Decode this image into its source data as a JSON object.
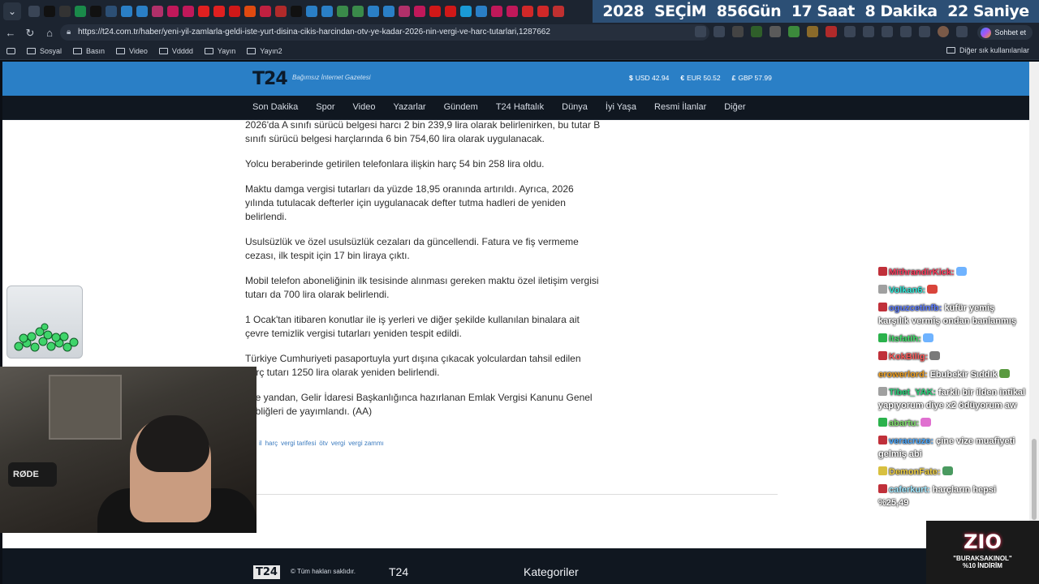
{
  "browser": {
    "countdown": [
      "2028",
      "SEÇİM",
      "856Gün",
      "17 Saat",
      "8 Dakika",
      "22 Saniye"
    ],
    "url": "https://t24.com.tr/haber/yeni-yil-zamlarla-geldi-iste-yurt-disina-cikis-harcindan-otv-ye-kadar-2026-nin-vergi-ve-harc-tutarlari,1287662",
    "sohbet_label": "Sohbet et",
    "bookmarks": [
      "Sosyal",
      "Basın",
      "Video",
      "Vdddd",
      "Yayın",
      "Yayın2"
    ],
    "bookmarks_other": "Diğer sık kullanılanlar"
  },
  "site": {
    "logo": "T24",
    "tagline": "Bağımsız İnternet Gazetesi",
    "rates": [
      {
        "sym": "$",
        "label": "USD 42.94"
      },
      {
        "sym": "€",
        "label": "EUR 50.52"
      },
      {
        "sym": "£",
        "label": "GBP 57.99"
      }
    ],
    "nav": [
      "Son Dakika",
      "Spor",
      "Video",
      "Yazarlar",
      "Gündem",
      "T24 Haftalık",
      "Dünya",
      "İyi Yaşa",
      "Resmi İlanlar",
      "Diğer"
    ]
  },
  "article": {
    "paragraphs": [
      "2026'da A sınıfı sürücü belgesi harcı 2 bin 239,9 lira olarak belirlenirken, bu tutar B sınıfı sürücü belgesi harçlarında 6 bin 754,60 lira olarak uygulanacak.",
      "Yolcu beraberinde getirilen telefonlara ilişkin harç 54 bin 258 lira oldu.",
      "Maktu damga vergisi tutarları da yüzde 18,95 oranında artırıldı. Ayrıca, 2026 yılında tutulacak defterler için uygulanacak defter tutma hadleri de yeniden belirlendi.",
      "Usulsüzlük ve özel usulsüzlük cezaları da güncellendi. Fatura ve fiş vermeme cezası, ilk tespit için 17 bin liraya çıktı.",
      "Mobil telefon aboneliğinin ilk tesisinde alınması gereken maktu özel iletişim vergisi tutarı da 700 lira olarak belirlendi.",
      "1 Ocak'tan itibaren konutlar ile iş yerleri ve diğer şekilde kullanılan binalara ait çevre temizlik vergisi tutarları yeniden tespit edildi.",
      "Türkiye Cumhuriyeti pasaportuyla yurt dışına çıkacak yolculardan tahsil edilen harç tutarı 1250 lira olarak yeniden belirlendi.",
      "Öte yandan, Gelir İdaresi Başkanlığınca hazırlanan Emlak Vergisi Kanunu Genel Tebliğleri de yayımlandı. (AA)"
    ],
    "tags": [
      "il",
      "harç",
      "vergi tarifesi",
      "ötv",
      "vergi",
      "vergi zammı"
    ]
  },
  "footer": {
    "logo": "T24",
    "copyright": "© Tüm hakları saklıdır.",
    "col1": "T24",
    "col2": "Kategoriler"
  },
  "webcam": {
    "mic_brand": "RØDE"
  },
  "chat": [
    {
      "user": "MithrandirKick:",
      "text": "",
      "color": "#ff3b5c",
      "badge": "#c0303a",
      "emote": "#6fb3ff"
    },
    {
      "user": "Volkan6:",
      "text": "",
      "color": "#2ee6d6",
      "badge": "#a0a0a0",
      "emote": "#d9453b"
    },
    {
      "user": "oguzcetinfb:",
      "text": "küfür yemiş karşılık vermiş ondan banlanmış",
      "color": "#5b7bff",
      "badge": "#c0303a",
      "emote": ""
    },
    {
      "user": "itsfatih:",
      "text": "",
      "color": "#3ee06a",
      "badge": "#2bb24c",
      "emote": "#6fb3ff"
    },
    {
      "user": "KokBilig:",
      "text": "",
      "color": "#ff5a5a",
      "badge": "#c0303a",
      "emote": "#7a7a7a"
    },
    {
      "user": "erowerlord:",
      "text": "Ebubekir Sıddık",
      "color": "#f0a020",
      "badge": "",
      "emote": "#5a9a40"
    },
    {
      "user": "Tibet_YAK:",
      "text": "farklı bir ilden intikal yapıyorum diye x2 ödüyorum aw",
      "color": "#29d17a",
      "badge": "#a0a0a0",
      "emote": ""
    },
    {
      "user": "abartu:",
      "text": "",
      "color": "#7ee06a",
      "badge": "#2bb24c",
      "emote": "#e070d0"
    },
    {
      "user": "veracruze:",
      "text": "çine vize muafiyeti gelmiş abi",
      "color": "#4aa8ff",
      "badge": "#c0303a",
      "emote": ""
    },
    {
      "user": "DemonFate:",
      "text": "",
      "color": "#f0d040",
      "badge": "#d8c040",
      "emote": "#4a9a60"
    },
    {
      "user": "caferkurt:",
      "text": "harçların hepsi %25,49",
      "color": "#a0e8ff",
      "badge": "#c0303a",
      "emote": ""
    }
  ],
  "promo": {
    "logo": "ZIO",
    "code": "\"BURAKSAKINOL\"",
    "discount": "%10 İNDİRİM"
  }
}
